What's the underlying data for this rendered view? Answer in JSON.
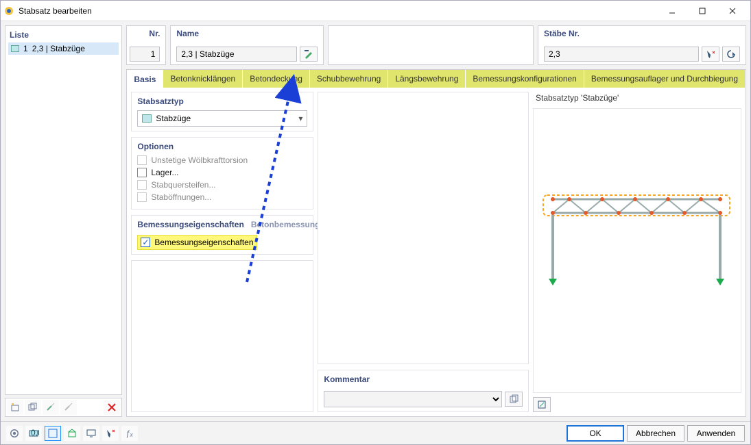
{
  "window": {
    "title": "Stabsatz bearbeiten"
  },
  "list": {
    "title": "Liste",
    "items": [
      {
        "num": "1",
        "label": "2,3 | Stabzüge"
      }
    ]
  },
  "fields": {
    "nr_label": "Nr.",
    "nr_value": "1",
    "name_label": "Name",
    "name_value": "2,3 | Stabzüge",
    "stabe_label": "Stäbe Nr.",
    "stabe_value": "2,3"
  },
  "tabs": {
    "items": [
      "Basis",
      "Betonknicklängen",
      "Betondeckung",
      "Schubbewehrung",
      "Längsbewehrung",
      "Bemessungskonfigurationen",
      "Bemessungsauflager und Durchbiegung"
    ],
    "active_index": 0
  },
  "form": {
    "stabsatz_label": "Stabsatztyp",
    "stabsatz_value": "Stabzüge",
    "optionen_label": "Optionen",
    "options": {
      "woelb": "Unstetige Wölbkrafttorsion",
      "lager": "Lager...",
      "quer": "Stabquersteifen...",
      "oeff": "Staböffnungen..."
    },
    "subtabs": {
      "a": "Bemessungseigenschaften",
      "b": "Betonbemessung"
    },
    "bemessung_checkbox": "Bemessungseigenschaften"
  },
  "comment": {
    "label": "Kommentar",
    "value": ""
  },
  "preview": {
    "head": "Stabsatztyp 'Stabzüge'"
  },
  "buttons": {
    "ok": "OK",
    "cancel": "Abbrechen",
    "apply": "Anwenden"
  }
}
